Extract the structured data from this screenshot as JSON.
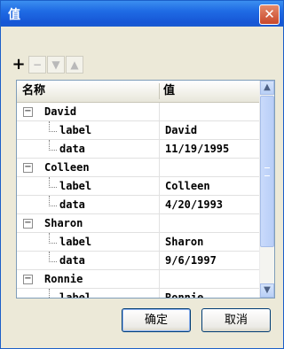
{
  "window": {
    "title": "值",
    "close_icon": "✕"
  },
  "toolbar": {
    "add_icon": "+",
    "remove_icon": "−",
    "down_icon": "▼",
    "up_icon": "▲"
  },
  "grid": {
    "columns": {
      "name": "名称",
      "value": "值"
    },
    "groups": [
      {
        "label": "David",
        "toggle": "−",
        "children": [
          {
            "label": "label",
            "value": "David"
          },
          {
            "label": "data",
            "value": "11/19/1995"
          }
        ]
      },
      {
        "label": "Colleen",
        "toggle": "−",
        "children": [
          {
            "label": "label",
            "value": "Colleen"
          },
          {
            "label": "data",
            "value": "4/20/1993"
          }
        ]
      },
      {
        "label": "Sharon",
        "toggle": "−",
        "children": [
          {
            "label": "label",
            "value": "Sharon"
          },
          {
            "label": "data",
            "value": "9/6/1997"
          }
        ]
      },
      {
        "label": "Ronnie",
        "toggle": "−",
        "children": [
          {
            "label": "label",
            "value": "Ronnie"
          }
        ]
      }
    ],
    "scroll_up_icon": "▲",
    "scroll_down_icon": "▼"
  },
  "buttons": {
    "ok": "确定",
    "cancel": "取消"
  },
  "colors": {
    "title_bar": "#1f6be4",
    "dialog_bg": "#ece9d8",
    "close_button": "#c8472a"
  }
}
